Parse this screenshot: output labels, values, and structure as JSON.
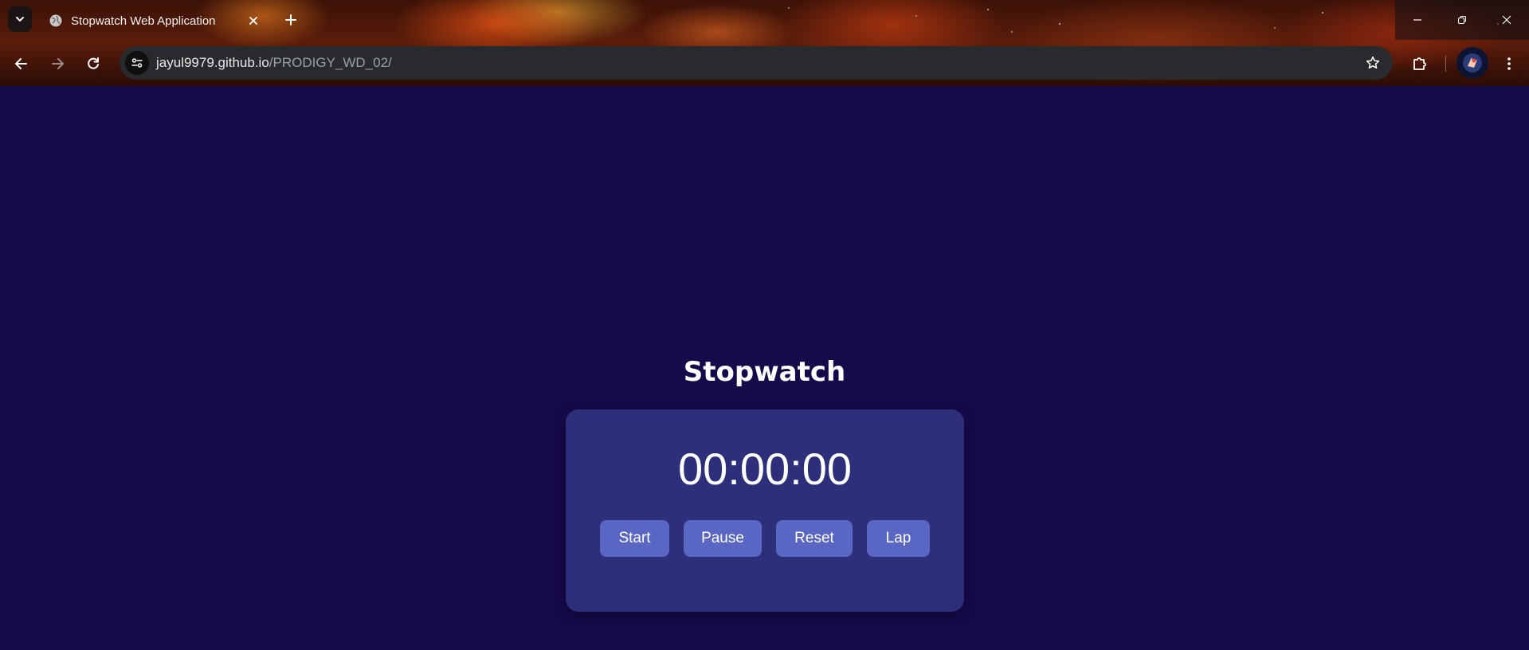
{
  "browser": {
    "tab": {
      "title": "Stopwatch Web Application",
      "favicon": "globe-icon"
    },
    "address_bar": {
      "host": "jayul9979.github.io",
      "path": "/PRODIGY_WD_02/"
    },
    "icons": {
      "tab_list": "chevron-down-icon",
      "close": "close-icon",
      "new_tab": "plus-icon",
      "back": "arrow-left-icon",
      "forward": "arrow-right-icon",
      "reload": "reload-icon",
      "site_info": "tune-icon",
      "bookmark": "star-icon",
      "extensions": "puzzle-icon",
      "menu": "more-vert-icon",
      "minimize": "minimize-icon",
      "restore": "restore-icon",
      "window_close": "window-close-icon"
    }
  },
  "page": {
    "background": "#170a4a",
    "title": "Stopwatch",
    "card_color": "#2e2f7a",
    "button_color": "#5a66c4",
    "time_display": "00:00:00",
    "buttons": {
      "start": "Start",
      "pause": "Pause",
      "reset": "Reset",
      "lap": "Lap"
    }
  }
}
